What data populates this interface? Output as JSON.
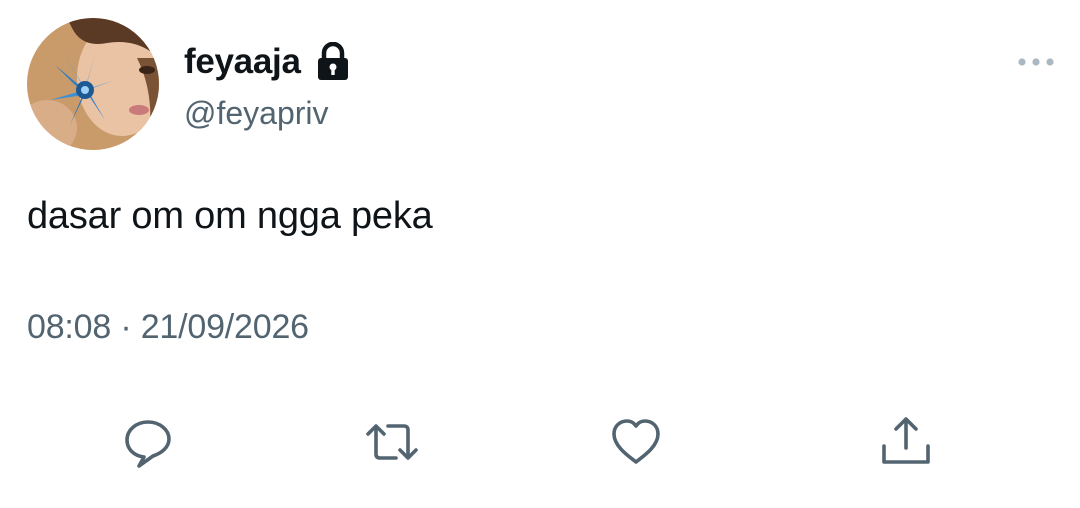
{
  "tweet": {
    "author": {
      "display_name": "feyaaja",
      "handle": "@feyapriv",
      "protected_icon": "lock-icon",
      "avatar_icon": "avatar-photo"
    },
    "text": "dasar om om ngga peka",
    "timestamp": "08:08 · 21/09/2026",
    "more_icon": "more-horizontal-icon",
    "actions": [
      {
        "name": "reply",
        "icon": "reply-icon"
      },
      {
        "name": "retweet",
        "icon": "retweet-icon"
      },
      {
        "name": "like",
        "icon": "heart-icon"
      },
      {
        "name": "share",
        "icon": "share-icon"
      }
    ],
    "colors": {
      "text_primary": "#0f1419",
      "text_secondary": "#536471",
      "icon": "#536471",
      "background": "#ffffff"
    }
  }
}
